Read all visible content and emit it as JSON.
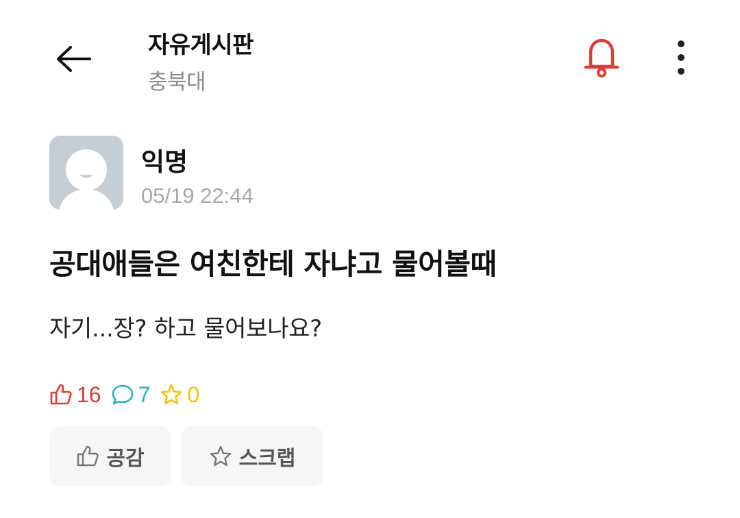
{
  "header": {
    "title": "자유게시판",
    "subtitle": "충북대",
    "back_icon": "arrow-left-icon",
    "bell_icon": "bell-icon",
    "more_icon": "more-vertical-icon",
    "bell_color": "#e53935"
  },
  "post": {
    "author": "익명",
    "time": "05/19 22:44",
    "title": "공대애들은 여친한테 자냐고 물어볼때",
    "body": "자기...장? 하고 물어보나요?"
  },
  "stats": {
    "likes": "16",
    "comments": "7",
    "scraps": "0",
    "like_color": "#e53935",
    "comment_color": "#1fb6c7",
    "scrap_color": "#f4c200"
  },
  "actions": {
    "like_label": "공감",
    "scrap_label": "스크랩"
  }
}
